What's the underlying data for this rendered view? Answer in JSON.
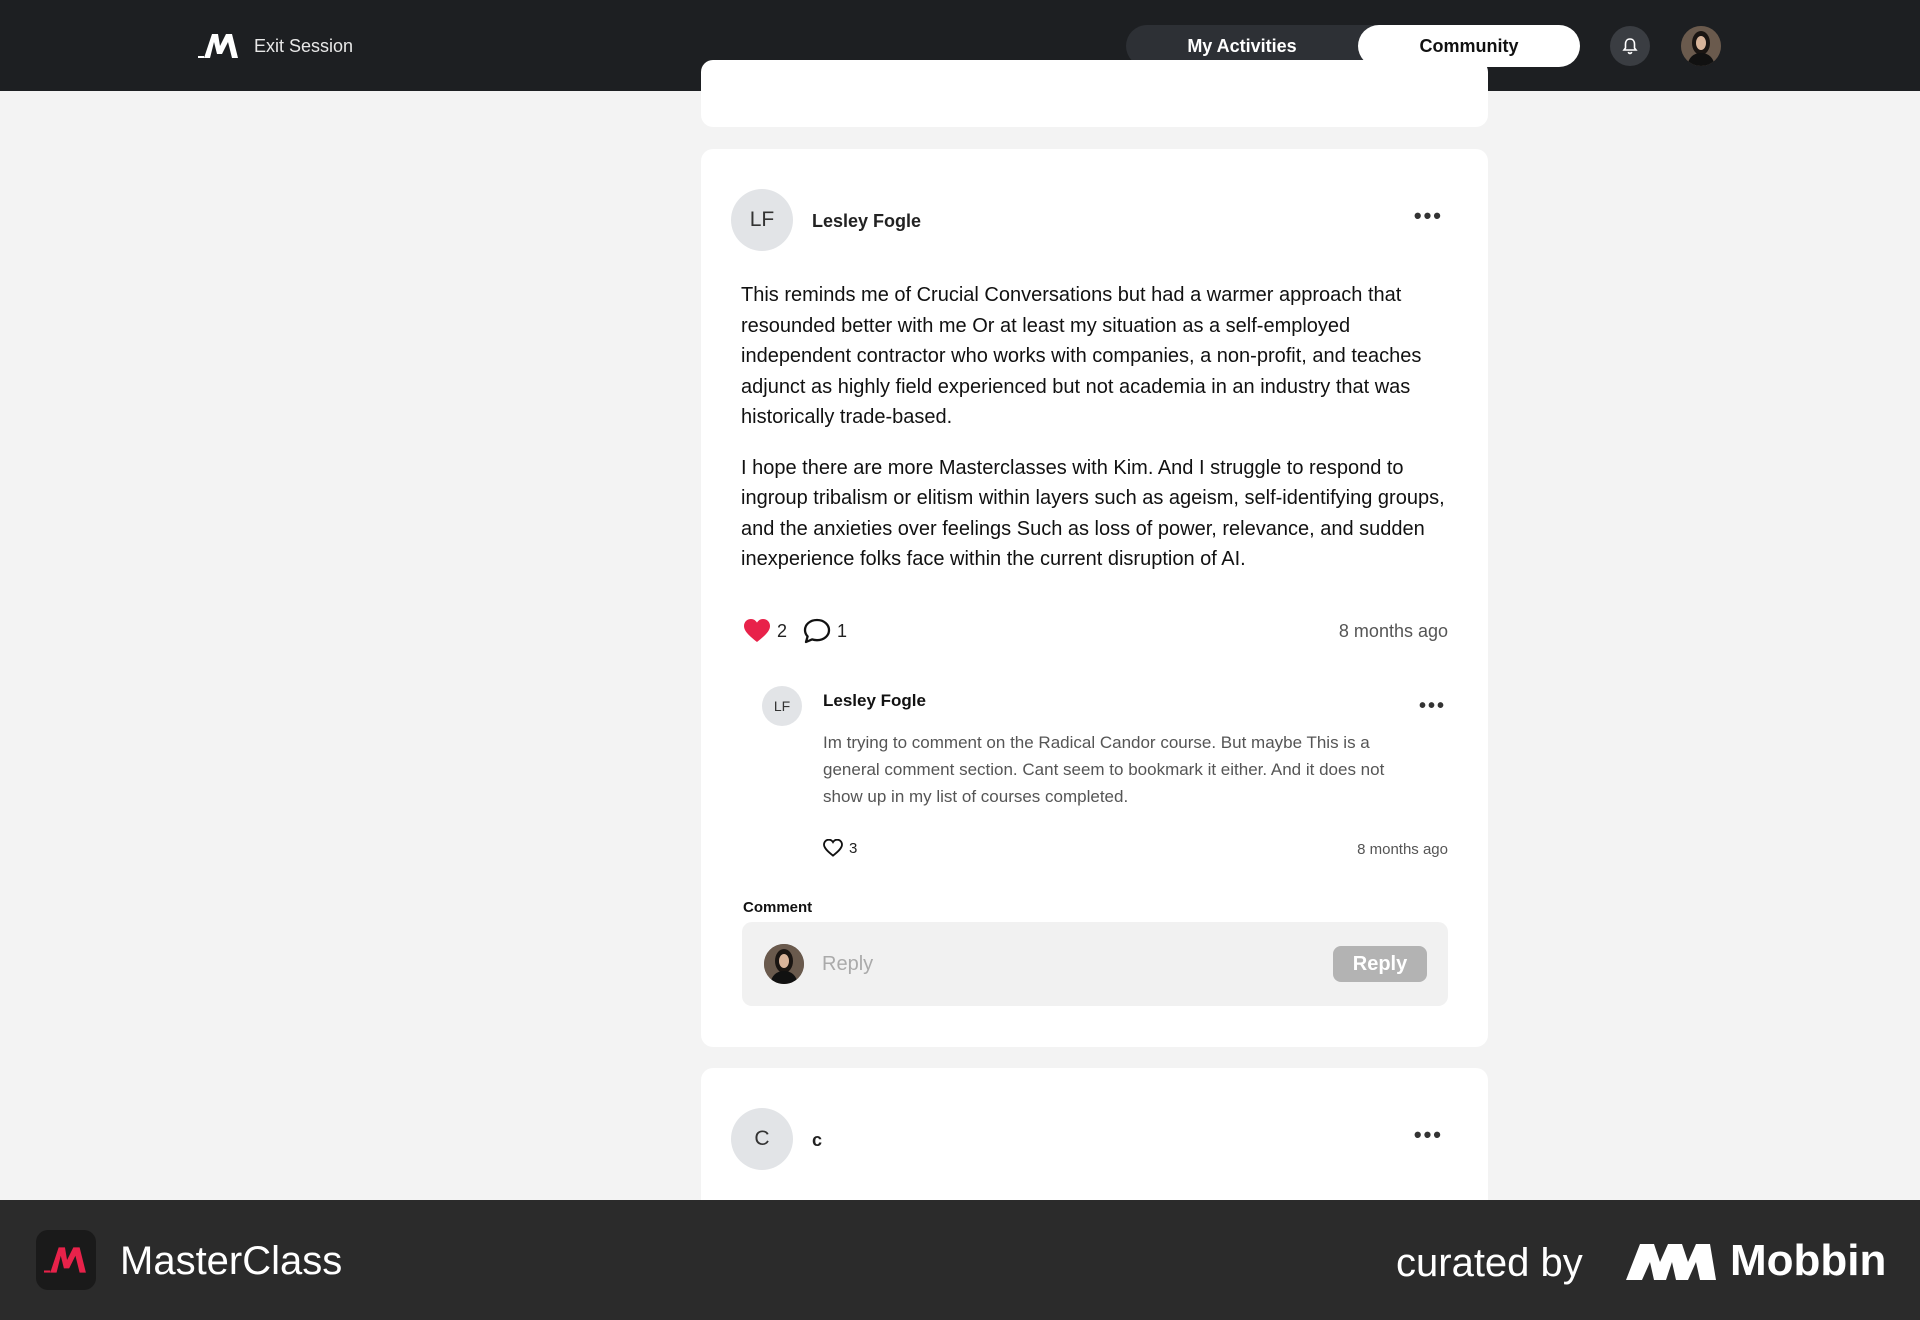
{
  "nav": {
    "exit_label": "Exit Session",
    "tabs": [
      "My Activities",
      "Community"
    ],
    "active_tab": "Community"
  },
  "post": {
    "avatar_initials": "LF",
    "author": "Lesley Fogle",
    "paragraphs": [
      "This reminds me of Crucial Conversations but had a warmer approach that resounded better with me Or at least my situation as a self-employed independent contractor who works with companies, a non-profit, and teaches adjunct as highly field experienced but not academia in an industry that was historically trade-based.",
      "I hope there are more Masterclasses with Kim. And I struggle to respond to ingroup tribalism or elitism within layers such as ageism, self-identifying groups, and the anxieties over feelings Such as loss of power, relevance, and sudden inexperience folks face within the current disruption of AI."
    ],
    "likes": "2",
    "comments": "1",
    "time": "8 months ago",
    "reply": {
      "avatar_initials": "LF",
      "author": "Lesley Fogle",
      "text": "Im trying to comment on the Radical Candor course. But maybe This is a general comment section. Cant seem to bookmark it either. And it does not show up in my list of courses completed.",
      "likes": "3",
      "time": "8 months ago"
    },
    "comment_label": "Comment",
    "comment_placeholder": "Reply",
    "comment_button": "Reply"
  },
  "next_post": {
    "avatar_initials": "C",
    "author": "c"
  },
  "footer": {
    "brand": "MasterClass",
    "curated": "curated by",
    "curator": "Mobbin"
  },
  "colors": {
    "heart": "#e8224a",
    "nav_bg": "#1d1f22",
    "page_bg": "#f3f3f3"
  }
}
